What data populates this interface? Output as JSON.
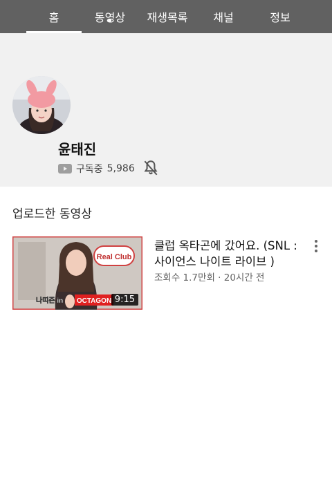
{
  "tabs": [
    {
      "label": "홈",
      "active": true
    },
    {
      "label": "동영상",
      "active": false,
      "has_dot": true
    },
    {
      "label": "재생목록",
      "active": false
    },
    {
      "label": "채널",
      "active": false
    },
    {
      "label": "정보",
      "active": false
    }
  ],
  "channel": {
    "name": "윤태진",
    "subscribe_label": "구독중",
    "subscriber_count": "5,986"
  },
  "section": {
    "title": "업로드한 동영상"
  },
  "video": {
    "title": "클럽 옥타곤에 갔어요. (SNL : 사이언스 나이트 라이브 )",
    "meta": "조회수 1.7만회 · 20시간 전",
    "duration": "9:15",
    "thumb_badge": "Real Club",
    "thumb_caption": "나띠즌 in",
    "thumb_brand": "OCTAGON"
  },
  "colors": {
    "tab_bar": "#616161",
    "header_bg": "#f1f1f1",
    "text_primary": "#111111",
    "text_secondary": "#666666"
  }
}
